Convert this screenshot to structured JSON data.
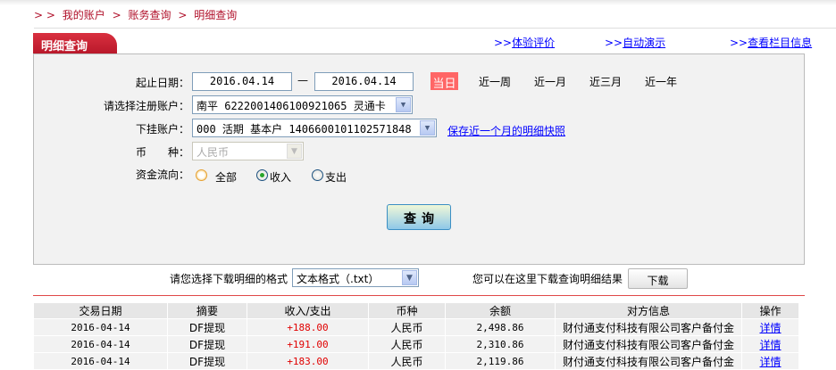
{
  "breadcrumb": [
    "> >",
    "我的账户",
    ">",
    "账务查询",
    ">",
    "明细查询"
  ],
  "tab_title": "明细查询",
  "top_links": [
    {
      "prefix": ">>",
      "label": "体验评价"
    },
    {
      "prefix": ">>",
      "label": "自动演示"
    },
    {
      "prefix": ">>",
      "label": "查看栏目信息"
    }
  ],
  "form": {
    "date_label": "起止日期：",
    "start_date": "2016.04.14",
    "date_sep": "—",
    "end_date": "2016.04.14",
    "quick_ranges": [
      "当日",
      "近一周",
      "近一月",
      "近三月",
      "近一年"
    ],
    "quick_selected": "当日",
    "account_label": "请选择注册账户：",
    "account_value": "南平 6222001406100921065 灵通卡",
    "sub_account_label": "下挂账户：",
    "sub_account_value": "000 活期 基本户 1406600101102571848",
    "snapshot_link": "保存近一个月的明细快照",
    "currency_label": "币　　种：",
    "currency_value": "人民币",
    "flow_label": "资金流向：",
    "flow_options": [
      "全部",
      "收入",
      "支出"
    ],
    "flow_selected": "收入",
    "query_button": "查询"
  },
  "download": {
    "format_label": "请您选择下载明细的格式",
    "format_value": "文本格式（.txt）",
    "hint": "您可以在这里下载查询明细结果",
    "button": "下载"
  },
  "table": {
    "headers": [
      "交易日期",
      "摘要",
      "收入/支出",
      "币种",
      "余额",
      "对方信息",
      "操作"
    ],
    "rows": [
      [
        "2016-04-14",
        "DF提现",
        "+188.00",
        "人民币",
        "2,498.86",
        "财付通支付科技有限公司客户备付金",
        "详情"
      ],
      [
        "2016-04-14",
        "DF提现",
        "+191.00",
        "人民币",
        "2,310.86",
        "财付通支付科技有限公司客户备付金",
        "详情"
      ],
      [
        "2016-04-14",
        "DF提现",
        "+183.00",
        "人民币",
        "2,119.86",
        "财付通支付科技有限公司客户备付金",
        "详情"
      ]
    ]
  },
  "colors": {
    "brand_red": "#c0192c",
    "today_bg": "#ff6666",
    "amount": "#e00000",
    "link": "#0000ff"
  }
}
